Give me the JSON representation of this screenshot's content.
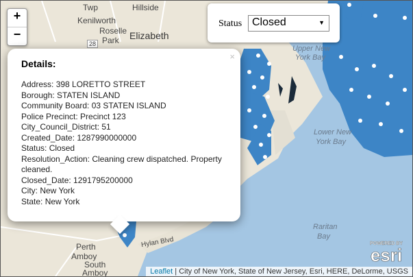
{
  "zoom": {
    "in_label": "+",
    "out_label": "−"
  },
  "status_filter": {
    "label": "Status",
    "selected": "Closed"
  },
  "popup": {
    "title": "Details:",
    "close": "×",
    "address": "Address: 398 LORETTO STREET",
    "borough": "Borough: STATEN ISLAND",
    "community_board": "Community Board: 03 STATEN ISLAND",
    "police_precinct": "Police Precinct: Precinct 123",
    "council_district": "City_Council_District: 51",
    "created_date": "Created_Date: 1287990000000",
    "status": "Status: Closed",
    "resolution": "Resolution_Action: Cleaning crew dispatched. Property cleaned.",
    "closed_date": "Closed_Date: 1291795200000",
    "city": "City: New York",
    "state": "State: New York"
  },
  "map_labels": {
    "twp": "Twp",
    "hillside": "Hillside",
    "kenilworth": "Kenilworth",
    "roselle": "Roselle",
    "roselle_park": "Roselle",
    "park": "Park",
    "elizabeth": "Elizabeth",
    "route": "28",
    "upper_ny_bay": "Upper New",
    "york_bay": "York Bay",
    "lower_ny_bay": "Lower New",
    "lower_york_bay": "York Bay",
    "raritan": "Raritan",
    "bay": "Bay",
    "perth": "Perth",
    "amboy": "Amboy",
    "south": "South",
    "south_amboy": "Amboy",
    "hylan": "Hylan Blvd"
  },
  "attribution": {
    "leaflet": "Leaflet",
    "text": " | City of New York, State of New Jersey, Esri, HERE, DeLorme, USGS",
    "powered": "POWERED BY",
    "esri": "esri"
  },
  "colors": {
    "marker": "#3d85c6",
    "water": "#a4c6e3",
    "land": "#ebe6d9"
  }
}
